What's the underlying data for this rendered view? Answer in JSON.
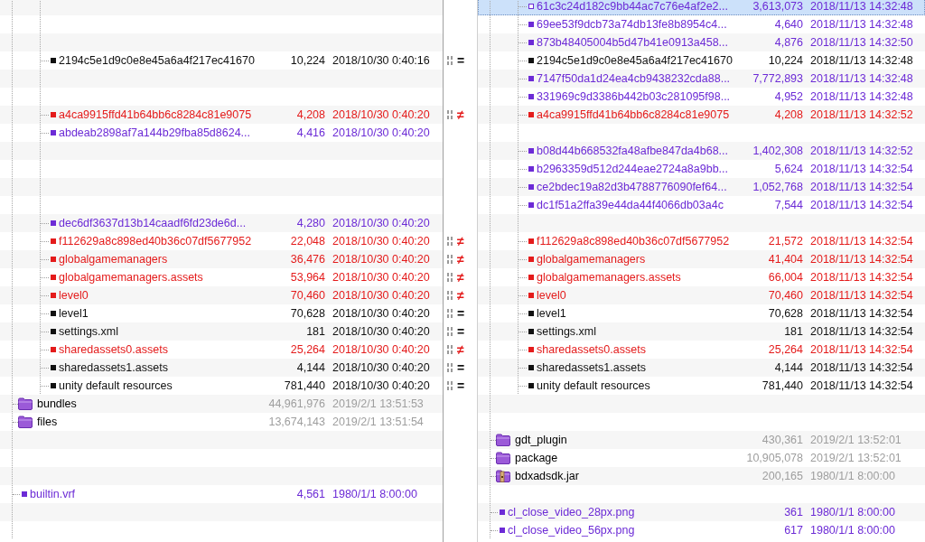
{
  "rows": [
    {
      "kind": "group",
      "children": [
        {
          "kind": "pair",
          "right": {
            "kind": "file",
            "color": "#6c2bd6",
            "name": "61c3c24d182c9bb44ac7c76e4af2e2...",
            "size": "3,613,073",
            "date": "2018/11/13 14:32:48",
            "selected": true
          }
        },
        {
          "kind": "pair",
          "right": {
            "kind": "file",
            "color": "#6c2bd6",
            "name": "69ee53f9dcb73a74db13fe8b8954c4...",
            "size": "4,640",
            "date": "2018/11/13 14:32:48",
            "selected": false
          }
        },
        {
          "kind": "pair",
          "right": {
            "kind": "file",
            "color": "#6c2bd6",
            "name": "873b48405004b5d47b41e0913a458...",
            "size": "4,876",
            "date": "2018/11/13 14:32:50",
            "selected": false
          }
        },
        {
          "kind": "pair",
          "left": {
            "kind": "file",
            "color": "#111111",
            "name": "2194c5e1d9c0e8e45a6a4f217ec41670",
            "size": "10,224",
            "date": "2018/10/30 0:40:16",
            "selected": false
          },
          "compare": {
            "kind": "equal",
            "mark": "="
          },
          "right": {
            "kind": "file",
            "color": "#111111",
            "name": "2194c5e1d9c0e8e45a6a4f217ec41670",
            "size": "10,224",
            "date": "2018/11/13 14:32:48",
            "selected": false
          }
        },
        {
          "kind": "pair",
          "right": {
            "kind": "file",
            "color": "#6c2bd6",
            "name": "7147f50da1d24ea4cb9438232cda88...",
            "size": "7,772,893",
            "date": "2018/11/13 14:32:48",
            "selected": false
          }
        },
        {
          "kind": "pair",
          "right": {
            "kind": "file",
            "color": "#6c2bd6",
            "name": "331969c9d3386b442b03c281095f98...",
            "size": "4,952",
            "date": "2018/11/13 14:32:48",
            "selected": false
          }
        },
        {
          "kind": "pair",
          "left": {
            "kind": "file",
            "color": "#e41b1b",
            "name": "a4ca9915ffd41b64bb6c8284c81e9075",
            "size": "4,208",
            "date": "2018/10/30 0:40:20",
            "selected": false
          },
          "compare": {
            "kind": "differs",
            "mark": "≠"
          },
          "right": {
            "kind": "file",
            "color": "#e41b1b",
            "name": "a4ca9915ffd41b64bb6c8284c81e9075",
            "size": "4,208",
            "date": "2018/11/13 14:32:52",
            "selected": false
          }
        },
        {
          "kind": "pair",
          "left": {
            "kind": "file",
            "color": "#6c2bd6",
            "name": "abdeab2898af7a144b29fba85d8624...",
            "size": "4,416",
            "date": "2018/10/30 0:40:20",
            "selected": false
          }
        },
        {
          "kind": "pair",
          "right": {
            "kind": "file",
            "color": "#6c2bd6",
            "name": "b08d44b668532fa48afbe847da4b68...",
            "size": "1,402,308",
            "date": "2018/11/13 14:32:52",
            "selected": false
          }
        },
        {
          "kind": "pair",
          "right": {
            "kind": "file",
            "color": "#6c2bd6",
            "name": "b2963359d512d244eae2724a8a9bb...",
            "size": "5,624",
            "date": "2018/11/13 14:32:54",
            "selected": false
          }
        },
        {
          "kind": "pair",
          "right": {
            "kind": "file",
            "color": "#6c2bd6",
            "name": "ce2bdec19a82d3b4788776090fef64...",
            "size": "1,052,768",
            "date": "2018/11/13 14:32:54",
            "selected": false
          }
        },
        {
          "kind": "pair",
          "right": {
            "kind": "file",
            "color": "#6c2bd6",
            "name": "dc1f51a2ffa39e44da44f4066db03a4c",
            "size": "7,544",
            "date": "2018/11/13 14:32:54",
            "selected": false
          }
        },
        {
          "kind": "pair",
          "left": {
            "kind": "file",
            "color": "#6c2bd6",
            "name": "dec6df3637d13b14caadf6fd23de6d...",
            "size": "4,280",
            "date": "2018/10/30 0:40:20",
            "selected": false
          }
        },
        {
          "kind": "pair",
          "left": {
            "kind": "file",
            "color": "#e41b1b",
            "name": "f112629a8c898ed40b36c07df5677952",
            "size": "22,048",
            "date": "2018/10/30 0:40:20",
            "selected": false
          },
          "compare": {
            "kind": "differs",
            "mark": "≠"
          },
          "right": {
            "kind": "file",
            "color": "#e41b1b",
            "name": "f112629a8c898ed40b36c07df5677952",
            "size": "21,572",
            "date": "2018/11/13 14:32:54",
            "selected": false
          }
        },
        {
          "kind": "pair",
          "left": {
            "kind": "file",
            "color": "#e41b1b",
            "name": "globalgamemanagers",
            "size": "36,476",
            "date": "2018/10/30 0:40:20",
            "selected": false
          },
          "compare": {
            "kind": "differs",
            "mark": "≠"
          },
          "right": {
            "kind": "file",
            "color": "#e41b1b",
            "name": "globalgamemanagers",
            "size": "41,404",
            "date": "2018/11/13 14:32:54",
            "selected": false
          }
        },
        {
          "kind": "pair",
          "left": {
            "kind": "file",
            "color": "#e41b1b",
            "name": "globalgamemanagers.assets",
            "size": "53,964",
            "date": "2018/10/30 0:40:20",
            "selected": false
          },
          "compare": {
            "kind": "differs",
            "mark": "≠"
          },
          "right": {
            "kind": "file",
            "color": "#e41b1b",
            "name": "globalgamemanagers.assets",
            "size": "66,004",
            "date": "2018/11/13 14:32:54",
            "selected": false
          }
        },
        {
          "kind": "pair",
          "left": {
            "kind": "file",
            "color": "#e41b1b",
            "name": "level0",
            "size": "70,460",
            "date": "2018/10/30 0:40:20",
            "selected": false
          },
          "compare": {
            "kind": "differs",
            "mark": "≠"
          },
          "right": {
            "kind": "file",
            "color": "#e41b1b",
            "name": "level0",
            "size": "70,460",
            "date": "2018/11/13 14:32:54",
            "selected": false
          }
        },
        {
          "kind": "pair",
          "left": {
            "kind": "file",
            "color": "#111111",
            "name": "level1",
            "size": "70,628",
            "date": "2018/10/30 0:40:20",
            "selected": false
          },
          "compare": {
            "kind": "equal",
            "mark": "="
          },
          "right": {
            "kind": "file",
            "color": "#111111",
            "name": "level1",
            "size": "70,628",
            "date": "2018/11/13 14:32:54",
            "selected": false
          }
        },
        {
          "kind": "pair",
          "left": {
            "kind": "file",
            "color": "#111111",
            "name": "settings.xml",
            "size": "181",
            "date": "2018/10/30 0:40:20",
            "selected": false
          },
          "compare": {
            "kind": "equal",
            "mark": "="
          },
          "right": {
            "kind": "file",
            "color": "#111111",
            "name": "settings.xml",
            "size": "181",
            "date": "2018/11/13 14:32:54",
            "selected": false
          }
        },
        {
          "kind": "pair",
          "left": {
            "kind": "file",
            "color": "#e41b1b",
            "name": "sharedassets0.assets",
            "size": "25,264",
            "date": "2018/10/30 0:40:20",
            "selected": false
          },
          "compare": {
            "kind": "differs",
            "mark": "≠"
          },
          "right": {
            "kind": "file",
            "color": "#e41b1b",
            "name": "sharedassets0.assets",
            "size": "25,264",
            "date": "2018/11/13 14:32:54",
            "selected": false
          }
        },
        {
          "kind": "pair",
          "left": {
            "kind": "file",
            "color": "#111111",
            "name": "sharedassets1.assets",
            "size": "4,144",
            "date": "2018/10/30 0:40:20",
            "selected": false
          },
          "compare": {
            "kind": "equal",
            "mark": "="
          },
          "right": {
            "kind": "file",
            "color": "#111111",
            "name": "sharedassets1.assets",
            "size": "4,144",
            "date": "2018/11/13 14:32:54",
            "selected": false
          }
        },
        {
          "kind": "pair",
          "left": {
            "kind": "file",
            "color": "#111111",
            "name": "unity default resources",
            "size": "781,440",
            "date": "2018/10/30 0:40:20",
            "selected": false
          },
          "compare": {
            "kind": "equal",
            "mark": "="
          },
          "right": {
            "kind": "file",
            "color": "#111111",
            "name": "unity default resources",
            "size": "781,440",
            "date": "2018/11/13 14:32:54",
            "selected": false
          }
        }
      ]
    },
    {
      "kind": "pair",
      "left": {
        "kind": "folder",
        "color": "#9e9e9e",
        "name": "bundles",
        "size": "44,961,976",
        "date": "2019/2/1 13:51:53",
        "selected": false
      }
    },
    {
      "kind": "pair",
      "left": {
        "kind": "folder",
        "color": "#9e9e9e",
        "name": "files",
        "size": "13,674,143",
        "date": "2019/2/1 13:51:54",
        "selected": false
      }
    },
    {
      "kind": "pair",
      "right": {
        "kind": "folder",
        "color": "#9e9e9e",
        "name": "gdt_plugin",
        "size": "430,361",
        "date": "2019/2/1 13:52:01",
        "selected": false
      }
    },
    {
      "kind": "pair",
      "right": {
        "kind": "folder",
        "color": "#9e9e9e",
        "name": "package",
        "size": "10,905,078",
        "date": "2019/2/1 13:52:01",
        "selected": false
      }
    },
    {
      "kind": "pair",
      "right": {
        "kind": "archive",
        "color": "#9e9e9e",
        "name": "bdxadsdk.jar",
        "size": "200,165",
        "date": "1980/1/1 8:00:00",
        "selected": false
      }
    },
    {
      "kind": "pair",
      "left": {
        "kind": "file",
        "color": "#6c2bd6",
        "name": "builtin.vrf",
        "size": "4,561",
        "date": "1980/1/1 8:00:00",
        "selected": false
      }
    },
    {
      "kind": "pair",
      "right": {
        "kind": "file",
        "color": "#6c2bd6",
        "name": "cl_close_video_28px.png",
        "size": "361",
        "date": "1980/1/1 8:00:00",
        "selected": false
      }
    },
    {
      "kind": "pair",
      "right": {
        "kind": "file",
        "color": "#6c2bd6",
        "name": "cl_close_video_56px.png",
        "size": "617",
        "date": "1980/1/1 8:00:00",
        "selected": false
      }
    }
  ]
}
